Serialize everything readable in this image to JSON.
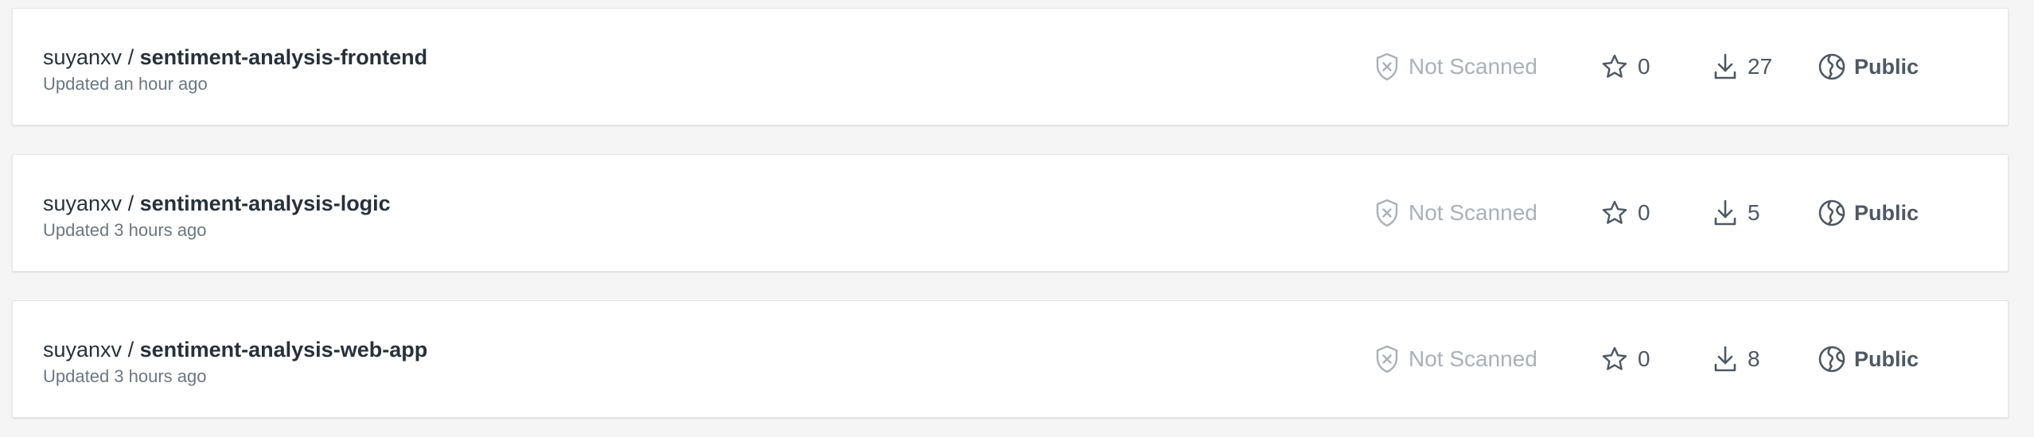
{
  "repositories": [
    {
      "namespace": "suyanxv",
      "separator": "/",
      "name": "sentiment-analysis-frontend",
      "updated": "Updated an hour ago",
      "scan_status": "Not Scanned",
      "stars": "0",
      "pulls": "27",
      "visibility": "Public"
    },
    {
      "namespace": "suyanxv",
      "separator": "/",
      "name": "sentiment-analysis-logic",
      "updated": "Updated 3 hours ago",
      "scan_status": "Not Scanned",
      "stars": "0",
      "pulls": "5",
      "visibility": "Public"
    },
    {
      "namespace": "suyanxv",
      "separator": "/",
      "name": "sentiment-analysis-web-app",
      "updated": "Updated 3 hours ago",
      "scan_status": "Not Scanned",
      "stars": "0",
      "pulls": "8",
      "visibility": "Public"
    }
  ],
  "icons": {
    "scan": "shield-x-icon",
    "stars": "star-icon",
    "pulls": "download-icon",
    "visibility": "globe-icon"
  },
  "colors": {
    "page_background": "#f5f5f5",
    "card_background": "#ffffff",
    "text_primary": "#27313b",
    "text_secondary": "#6b7782",
    "text_muted": "#aab1b8",
    "stat_text": "#4d5863"
  }
}
